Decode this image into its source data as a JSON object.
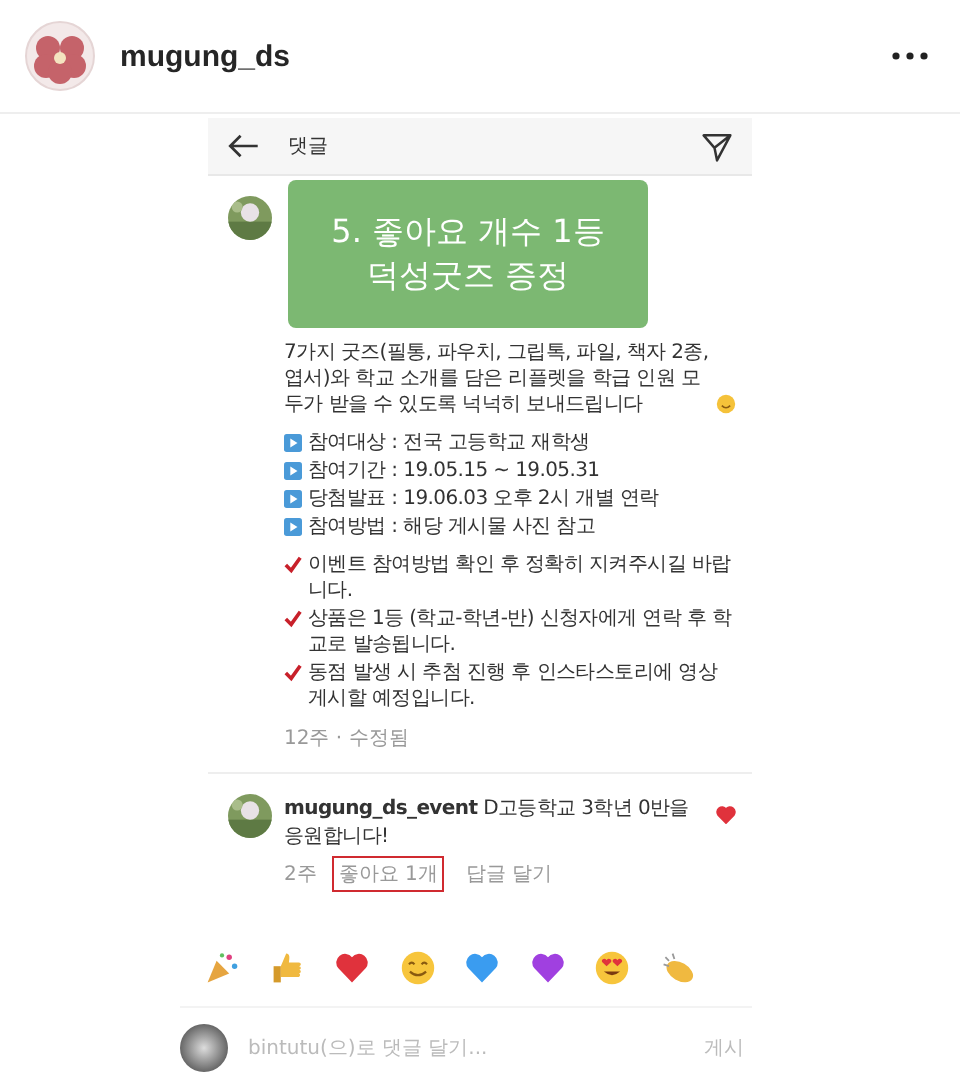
{
  "post_header": {
    "username": "mugung_ds"
  },
  "screenshot": {
    "title": "댓글",
    "overlay_lines": [
      "5. 좋아요 개수 1등",
      "덕성굿즈 증정"
    ],
    "caption": "7가지 굿즈(필통, 파우치, 그립톡, 파일, 책자 2종, 엽서)와 학교 소개를 담은 리플렛을 학급 인원 모두가 받을 수 있도록 넉넉히 보내드립니다",
    "details": [
      "참여대상 : 전국 고등학교 재학생",
      "참여기간 : 19.05.15 ~ 19.05.31",
      "당첨발표 : 19.06.03 오후 2시 개별 연락",
      "참여방법 : 해당 게시물 사진 참고"
    ],
    "notes": [
      "이벤트 참여방법 확인 후 정확히 지켜주시길 바랍니다.",
      "상품은 1등 (학교-학년-반) 신청자에게 연락 후 학교로 발송됩니다.",
      "동점 발생 시 추첨 진행 후 인스타스토리에 영상 게시할 예정입니다."
    ],
    "caption_meta": "12주 · 수정됨",
    "comment": {
      "text": "**mugung_ds_event** D고등학교 3학년 0반을 응원합니다!",
      "time": "2주",
      "likes": "좋아요 1개",
      "likes_highlighted": true,
      "reply": "답글 달기",
      "liked": true
    },
    "reactions": [
      {
        "kind": "party"
      },
      {
        "kind": "thumbs"
      },
      {
        "kind": "red-heart"
      },
      {
        "kind": "smile"
      },
      {
        "kind": "blue-heart"
      },
      {
        "kind": "purple-heart"
      },
      {
        "kind": "heart-eyes"
      },
      {
        "kind": "clap"
      }
    ],
    "composer": {
      "placeholder": "bintutu(으)로 댓글 달기...",
      "post": "게시"
    }
  }
}
